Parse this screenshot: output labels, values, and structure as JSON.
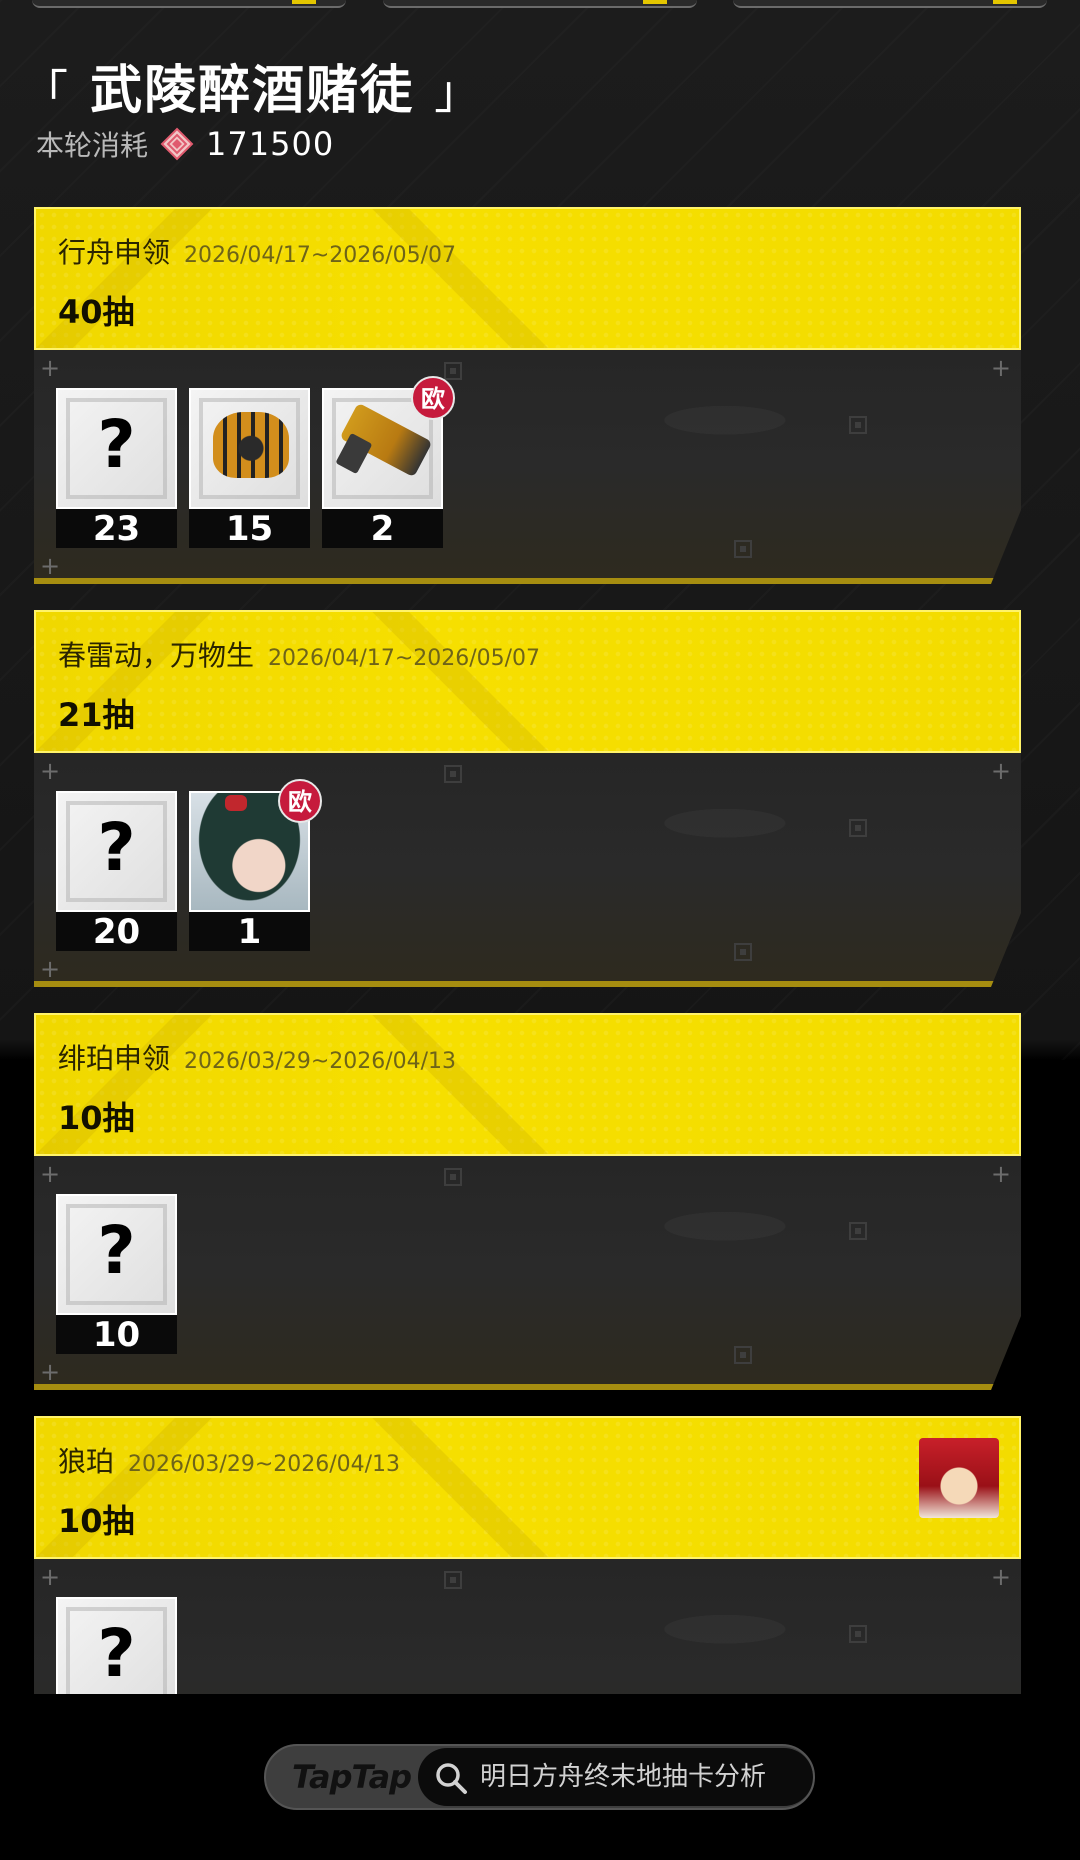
{
  "header": {
    "title": "武陵醉酒赌徒",
    "bracket_open": "「",
    "bracket_close": "」",
    "cost_label": "本轮消耗",
    "cost_value": "171500",
    "cost_icon": "diamond-currency-icon"
  },
  "pools": [
    {
      "name": "行舟申领",
      "date": "2026/04/17~2026/05/07",
      "count": "40抽",
      "items": [
        {
          "type": "unknown",
          "mark": "?",
          "count": "23"
        },
        {
          "type": "spider-mech",
          "count": "15"
        },
        {
          "type": "gun",
          "count": "2",
          "badge": "欧"
        }
      ]
    },
    {
      "name": "春雷动，万物生",
      "date": "2026/04/17~2026/05/07",
      "count": "21抽",
      "items": [
        {
          "type": "unknown",
          "mark": "?",
          "count": "20"
        },
        {
          "type": "character",
          "count": "1",
          "badge": "欧"
        }
      ]
    },
    {
      "name": "绯珀申领",
      "date": "2026/03/29~2026/04/13",
      "count": "10抽",
      "items": [
        {
          "type": "unknown",
          "mark": "?",
          "count": "10"
        }
      ]
    },
    {
      "name": "狼珀",
      "date": "2026/03/29~2026/04/13",
      "count": "10抽",
      "avatar": "character-avatar",
      "items": [
        {
          "type": "unknown",
          "mark": "?",
          "count": ""
        }
      ]
    }
  ],
  "bottom_bar": {
    "logo": "TapTap",
    "search_text": "明日方舟终末地抽卡分析"
  },
  "colors": {
    "accent_yellow": "#f3dc00",
    "badge_red": "#c61a3c",
    "background": "#1c1c1c"
  }
}
